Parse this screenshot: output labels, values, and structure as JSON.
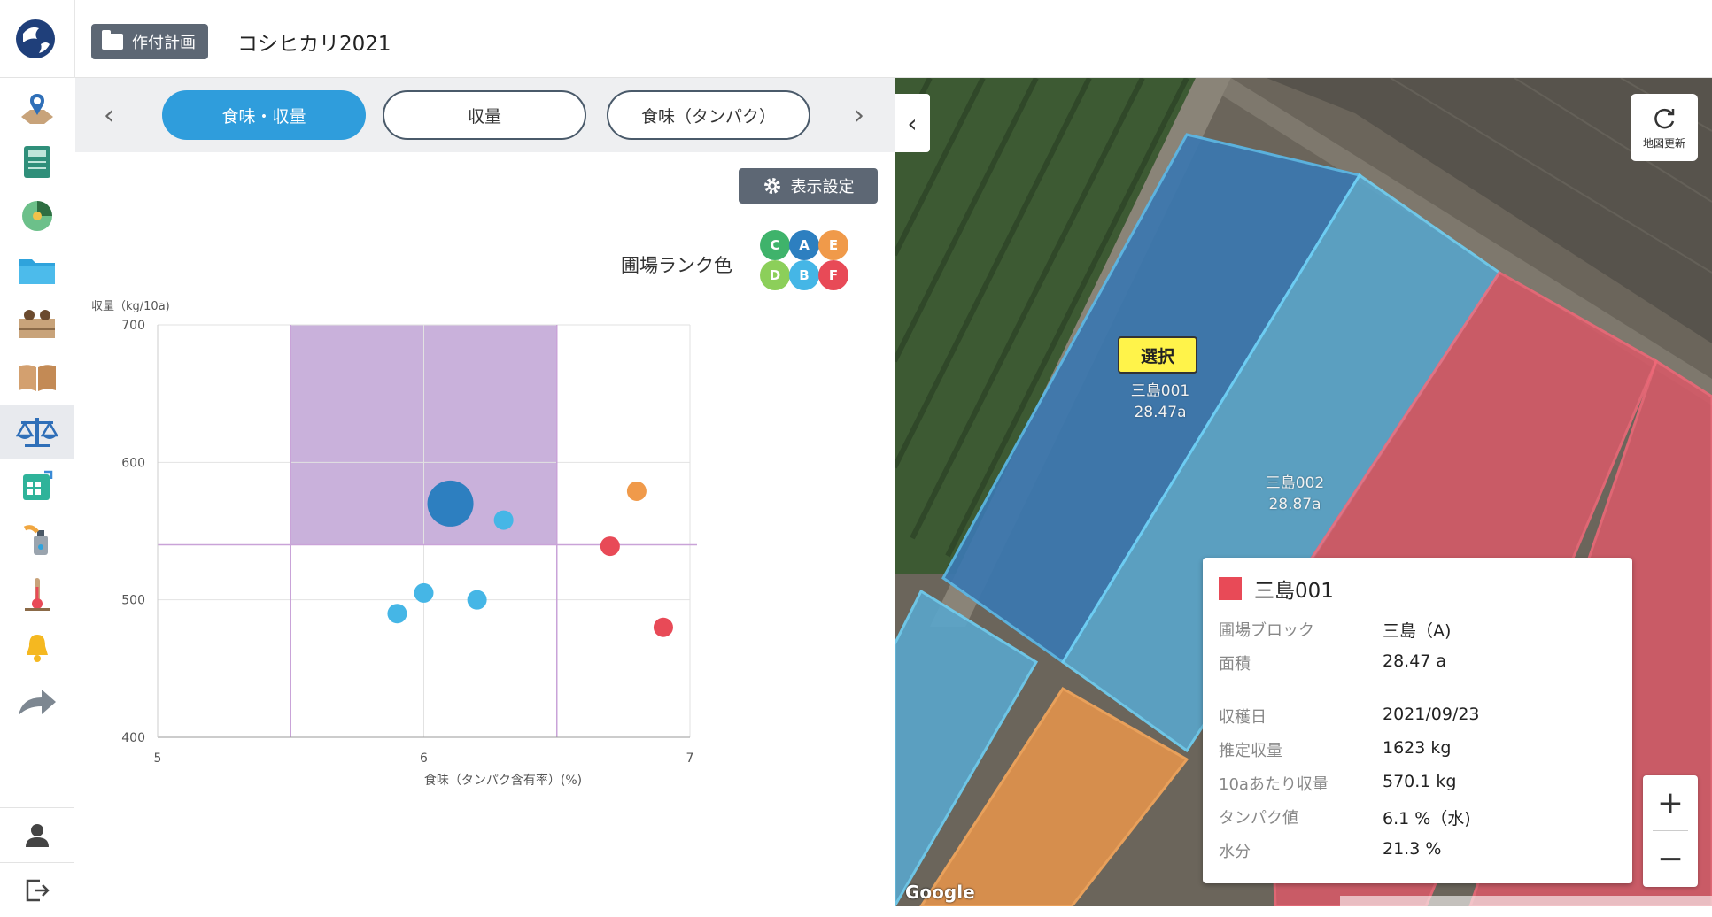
{
  "header": {
    "plan_badge": "作付計画",
    "crop_name": "コシヒカリ2021"
  },
  "sidebar": {
    "items": [
      {
        "icon": "map-pin-icon",
        "active": false
      },
      {
        "icon": "calculator-icon",
        "active": false
      },
      {
        "icon": "pie-chart-icon",
        "active": false
      },
      {
        "icon": "folder-icon",
        "active": false
      },
      {
        "icon": "records-icon",
        "active": false
      },
      {
        "icon": "book-icon",
        "active": false
      },
      {
        "icon": "scale-icon",
        "active": true
      },
      {
        "icon": "calendar-icon",
        "active": false
      },
      {
        "icon": "spray-icon",
        "active": false
      },
      {
        "icon": "thermometer-icon",
        "active": false
      },
      {
        "icon": "bell-icon",
        "active": false
      },
      {
        "icon": "share-arrow-icon",
        "active": false
      }
    ],
    "bottom": [
      {
        "icon": "user-icon"
      },
      {
        "icon": "logout-icon"
      }
    ]
  },
  "tabs": {
    "prev": "‹",
    "next": "›",
    "items": [
      {
        "label": "食味・収量",
        "active": true
      },
      {
        "label": "収量",
        "active": false
      },
      {
        "label": "食味（タンパク）",
        "active": false
      }
    ]
  },
  "display_settings": "表示設定",
  "rank_legend": {
    "label": "圃場ランク色",
    "ranks": [
      {
        "letter": "C",
        "color": "#3fb36b"
      },
      {
        "letter": "A",
        "color": "#2d7fc0"
      },
      {
        "letter": "E",
        "color": "#f09a4a"
      },
      {
        "letter": "D",
        "color": "#8ccf5a"
      },
      {
        "letter": "B",
        "color": "#45b6e6"
      },
      {
        "letter": "F",
        "color": "#e84a57"
      }
    ]
  },
  "chart_data": {
    "type": "scatter",
    "xlabel": "食味（タンパク含有率）(%)",
    "ylabel": "収量（kg/10a)",
    "xlim": [
      5,
      7
    ],
    "ylim": [
      400,
      700
    ],
    "xticks": [
      "5",
      "6",
      "7"
    ],
    "yticks": [
      "700",
      "600",
      "500",
      "400"
    ],
    "highlight_region": {
      "x": [
        5.5,
        6.5
      ],
      "y": [
        540,
        700
      ],
      "color": "#c9b1db"
    },
    "reference_lines": {
      "x": [
        5.5,
        6.5
      ],
      "y": 540
    },
    "points": [
      {
        "x": 6.1,
        "y": 570,
        "size": "large",
        "color": "#2d7fc0"
      },
      {
        "x": 6.3,
        "y": 558,
        "size": "small",
        "color": "#45b6e6"
      },
      {
        "x": 6.8,
        "y": 579,
        "size": "small",
        "color": "#f09a4a"
      },
      {
        "x": 6.7,
        "y": 539,
        "size": "small",
        "color": "#e84a57"
      },
      {
        "x": 6.0,
        "y": 505,
        "size": "small",
        "color": "#45b6e6"
      },
      {
        "x": 6.2,
        "y": 500,
        "size": "small",
        "color": "#45b6e6"
      },
      {
        "x": 5.9,
        "y": 490,
        "size": "small",
        "color": "#45b6e6"
      },
      {
        "x": 6.9,
        "y": 480,
        "size": "small",
        "color": "#e84a57"
      }
    ]
  },
  "map": {
    "collapse": "‹",
    "refresh_label": "地図更新",
    "select_tag": "選択",
    "fields": [
      {
        "name": "三島001",
        "area": "28.47a"
      },
      {
        "name": "三島002",
        "area": "28.87a"
      }
    ],
    "info": {
      "title": "三島001",
      "color": "#e84a57",
      "rows": [
        {
          "key": "圃場ブロック",
          "value": "三島（A)"
        },
        {
          "key": "面積",
          "value": "28.47 a"
        },
        {
          "key": "収穫日",
          "value": "2021/09/23"
        },
        {
          "key": "推定収量",
          "value": "1623 kg"
        },
        {
          "key": "10aあたり収量",
          "value": "570.1 kg"
        },
        {
          "key": "タンパク値",
          "value": "6.1 %（水)"
        },
        {
          "key": "水分",
          "value": "21.3 %"
        }
      ]
    },
    "zoom_in": "+",
    "zoom_out": "−",
    "google": "Google"
  }
}
